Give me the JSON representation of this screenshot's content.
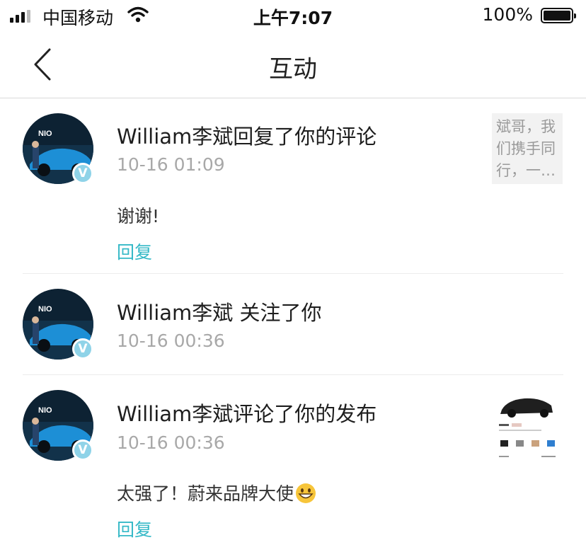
{
  "status_bar": {
    "carrier": "中国移动",
    "time": "上午7:07",
    "battery": "100%"
  },
  "nav": {
    "title": "互动"
  },
  "notifications": [
    {
      "title": "William李斌回复了你的评论",
      "time": "10-16 01:09",
      "text": "谢谢!",
      "reply_label": "回复",
      "quote_lines": [
        "斌哥，我",
        "们携手同",
        "行，一…"
      ]
    },
    {
      "title": "William李斌 关注了你",
      "time": "10-16 00:36"
    },
    {
      "title": "William李斌评论了你的发布",
      "time": "10-16 00:36",
      "text": "太强了！蔚来品牌大使",
      "reply_label": "回复"
    }
  ],
  "colors": {
    "accent": "#35b9c7",
    "verified_badge": "#8fd3e8",
    "time_text": "#a8a8a8"
  },
  "icons": {
    "back": "chevron-left-icon",
    "verified": "verified-v-icon",
    "emoji": "grinning-face-icon"
  }
}
